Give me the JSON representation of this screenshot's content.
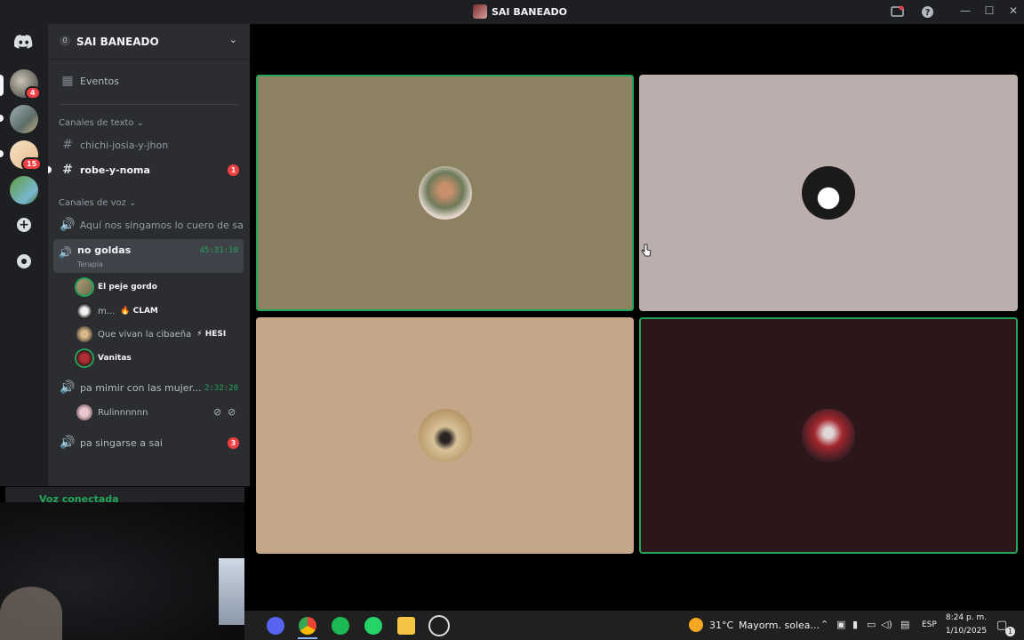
{
  "window": {
    "title": "SAI BANEADO",
    "controls": {
      "minimize": "—",
      "maximize": "☐",
      "close": "✕"
    }
  },
  "rail": {
    "home_icon": "discord-logo-icon",
    "badges": [
      "4",
      "15"
    ],
    "add_icon": "plus-icon",
    "explore_icon": "compass-icon"
  },
  "sidebar": {
    "server_name": "SAI BANEADO",
    "server_boost": "0",
    "events_label": "Eventos",
    "text_category": "Canales de texto ⌄",
    "text_channels": [
      {
        "name": "chichi-josia-y-jhon",
        "unread": ""
      },
      {
        "name": "robe-y-noma",
        "unread": "1"
      }
    ],
    "voice_category": "Canales de voz ⌄",
    "voice_channels": [
      {
        "name": "Aquí nos singamos lo cuero de sai"
      },
      {
        "name": "no goldas",
        "subtitle": "Terapia",
        "timer": "45:31:10"
      },
      {
        "name": "pa mimir con las mujer...",
        "timer": "2:32:20"
      },
      {
        "name": "pa singarse a sai",
        "badge": "3"
      }
    ],
    "members_no_goldas": [
      {
        "name": "El peje gordo",
        "tag": ""
      },
      {
        "name": "m...",
        "tag": "🔥 CLAM"
      },
      {
        "name": "Que vivan la cibaeña",
        "tag": "⚡ HESI"
      },
      {
        "name": "Vanitas",
        "tag": ""
      }
    ],
    "members_pa_mimir": [
      {
        "name": "Rulinnnnnn"
      }
    ],
    "voice_connected": "Voz conectada"
  },
  "taskbar": {
    "weather": "31°C",
    "weather_desc": "Mayorm. solea...",
    "lang": "ESP",
    "time": "8:24 p. m.",
    "date": "1/10/2025",
    "notif_count": "1"
  },
  "colors": {
    "speaking_ring": "#23a559",
    "tile_1": "#8c8262",
    "tile_2": "#bdaeae",
    "tile_3": "#c4a789",
    "tile_4": "#2b1719"
  }
}
